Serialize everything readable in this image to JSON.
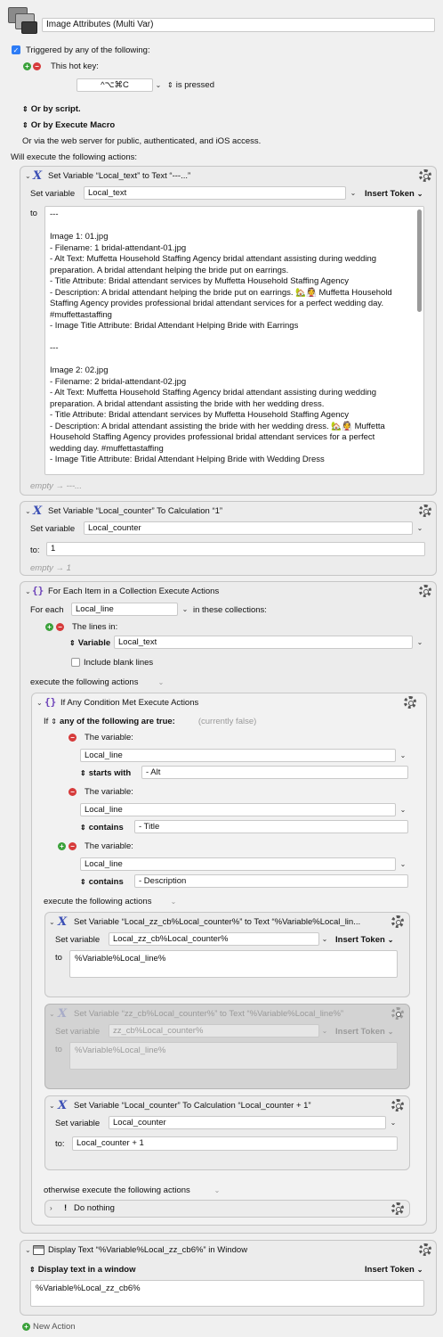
{
  "macro": {
    "name": "Image Attributes (Multi Var)",
    "triggered_label": "Triggered by any of the following:",
    "hotkey_label": "This hot key:",
    "hotkey_value": "^⌥⌘C",
    "hotkey_state": "is pressed",
    "or_script": "Or by script.",
    "or_execute_macro": "Or by Execute Macro",
    "web_server": "Or via the web server for public, authenticated, and iOS access.",
    "will_execute": "Will execute the following actions:"
  },
  "action1": {
    "title": "Set Variable “Local_text” to Text “---...”",
    "set_variable_label": "Set variable",
    "variable": "Local_text",
    "insert_token": "Insert Token",
    "to_label": "to",
    "text_lines": [
      "---",
      "",
      "Image 1: 01.jpg",
      "- Filename: 1 bridal-attendant-01.jpg",
      "- Alt Text: Muffetta Household Staffing Agency bridal attendant assisting during wedding",
      "preparation. A bridal attendant helping the bride put on earrings.",
      "- Title Attribute: Bridal attendant services by Muffetta Household Staffing Agency",
      "- Description: A bridal attendant helping the bride put on earrings. 🏡👰 Muffetta Household",
      "Staffing Agency provides professional bridal attendant services for a perfect wedding day.",
      "#muffettastaffing",
      "- Image Title Attribute: Bridal Attendant Helping Bride with Earrings",
      "",
      "---",
      "",
      "Image 2: 02.jpg",
      "- Filename: 2 bridal-attendant-02.jpg",
      "- Alt Text: Muffetta Household Staffing Agency bridal attendant assisting during wedding",
      "preparation. A bridal attendant assisting the bride with her wedding dress.",
      "- Title Attribute: Bridal attendant services by Muffetta Household Staffing Agency",
      "- Description: A bridal attendant assisting the bride with her wedding dress. 🏡👰 Muffetta",
      "Household Staffing Agency provides professional bridal attendant services for a perfect",
      "wedding day. #muffettastaffing",
      "- Image Title Attribute: Bridal Attendant Helping Bride with Wedding Dress"
    ],
    "result": "empty → ---..."
  },
  "action2": {
    "title": "Set Variable “Local_counter” To Calculation “1”",
    "set_variable_label": "Set variable",
    "variable": "Local_counter",
    "to_label": "to:",
    "value": "1",
    "result": "empty → 1"
  },
  "action3": {
    "title": "For Each Item in a Collection Execute Actions",
    "for_each_label": "For each",
    "variable": "Local_line",
    "in_collections": "in these collections:",
    "lines_in": "The lines in:",
    "variable_label": "Variable",
    "variable_value": "Local_text",
    "include_blank": "Include blank lines",
    "execute_label": "execute the following actions"
  },
  "if_action": {
    "title": "If Any Condition Met Execute Actions",
    "if_label": "If",
    "any_label": "any of the following are true:",
    "currently": "(currently false)",
    "conditions": [
      {
        "label": "The variable:",
        "variable": "Local_line",
        "op": "starts with",
        "value": "- Alt"
      },
      {
        "label": "The variable:",
        "variable": "Local_line",
        "op": "contains",
        "value": "- Title"
      },
      {
        "label": "The variable:",
        "variable": "Local_line",
        "op": "contains",
        "value": "- Description"
      }
    ],
    "execute_label": "execute the following actions",
    "otherwise_label": "otherwise execute the following actions",
    "do_nothing": "Do nothing"
  },
  "sub1": {
    "title": "Set Variable “Local_zz_cb%Local_counter%” to Text “%Variable%Local_lin...",
    "set_variable_label": "Set variable",
    "variable": "Local_zz_cb%Local_counter%",
    "insert_token": "Insert Token",
    "to_label": "to",
    "text": "%Variable%Local_line%"
  },
  "sub2": {
    "title": "Set Variable “zz_cb%Local_counter%” to Text “%Variable%Local_line%”",
    "set_variable_label": "Set variable",
    "variable": "zz_cb%Local_counter%",
    "insert_token": "Insert Token",
    "to_label": "to",
    "text": "%Variable%Local_line%"
  },
  "sub3": {
    "title": "Set Variable “Local_counter” To Calculation “Local_counter + 1”",
    "set_variable_label": "Set variable",
    "variable": "Local_counter",
    "to_label": "to:",
    "value": "Local_counter + 1"
  },
  "action4": {
    "title": "Display Text “%Variable%Local_zz_cb6%” in Window",
    "display_label": "Display text in a window",
    "insert_token": "Insert Token",
    "text": "%Variable%Local_zz_cb6%"
  },
  "new_action": "New Action"
}
